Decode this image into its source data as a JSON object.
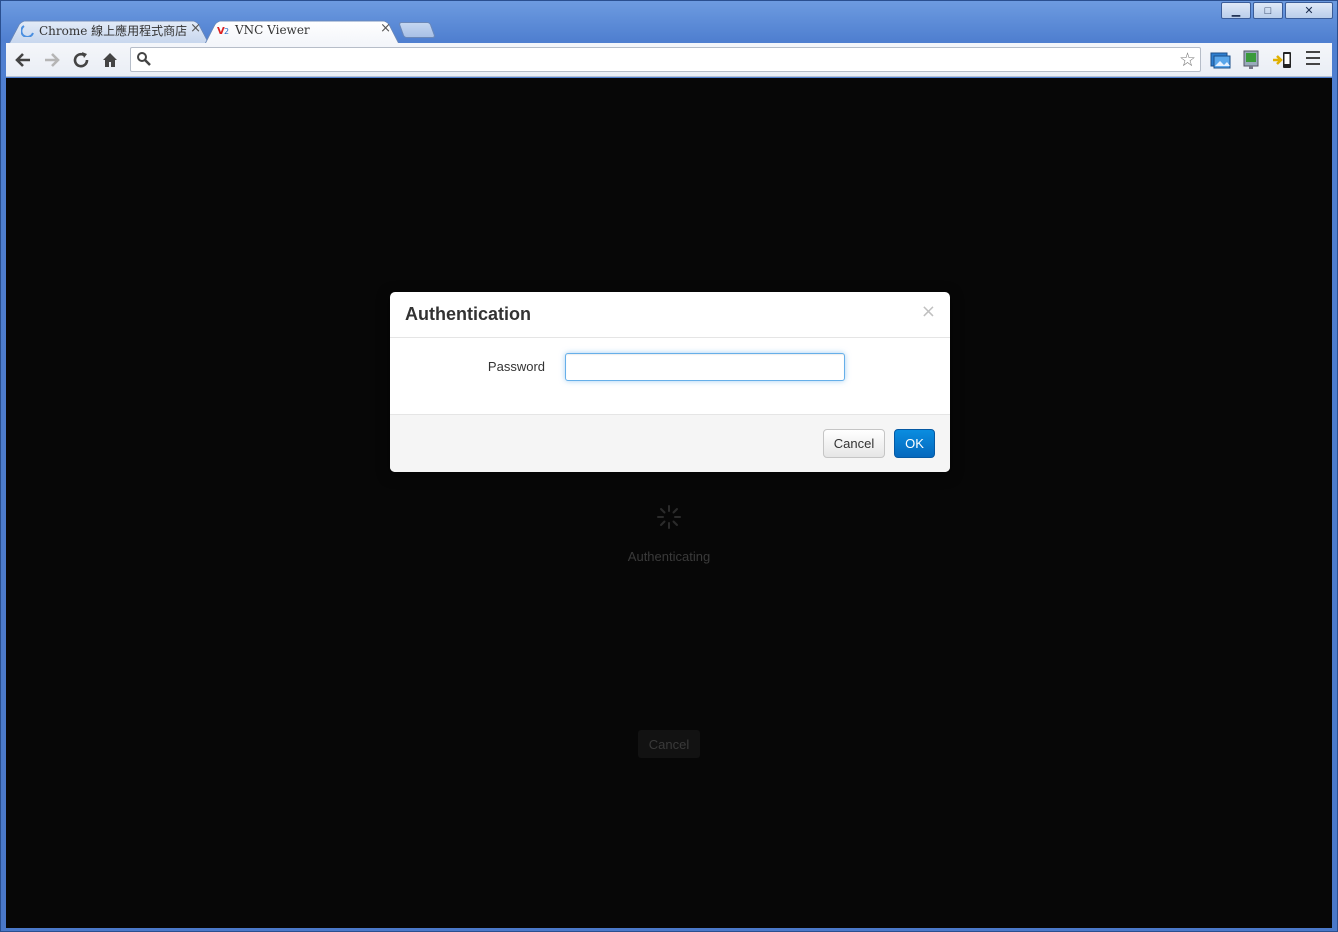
{
  "browser": {
    "tabs": [
      {
        "title": "Chrome 線上應用程式商店",
        "active": false,
        "favicon": "chrome-store-icon"
      },
      {
        "title": "VNC Viewer",
        "active": true,
        "favicon": "vnc-icon"
      }
    ],
    "window_controls": {
      "minimize": "▁",
      "maximize": "□",
      "close": "✕"
    },
    "tab_close": "×",
    "omnibox": {
      "value": "",
      "placeholder": ""
    }
  },
  "background": {
    "status": "Authenticating",
    "cancel_label": "Cancel"
  },
  "dialog": {
    "title": "Authentication",
    "close_glyph": "×",
    "password_label": "Password",
    "password_value": "",
    "cancel_label": "Cancel",
    "ok_label": "OK"
  },
  "colors": {
    "content_bg": "#070707",
    "ok_button": "#0568bd",
    "focus_ring": "#66afe9"
  }
}
